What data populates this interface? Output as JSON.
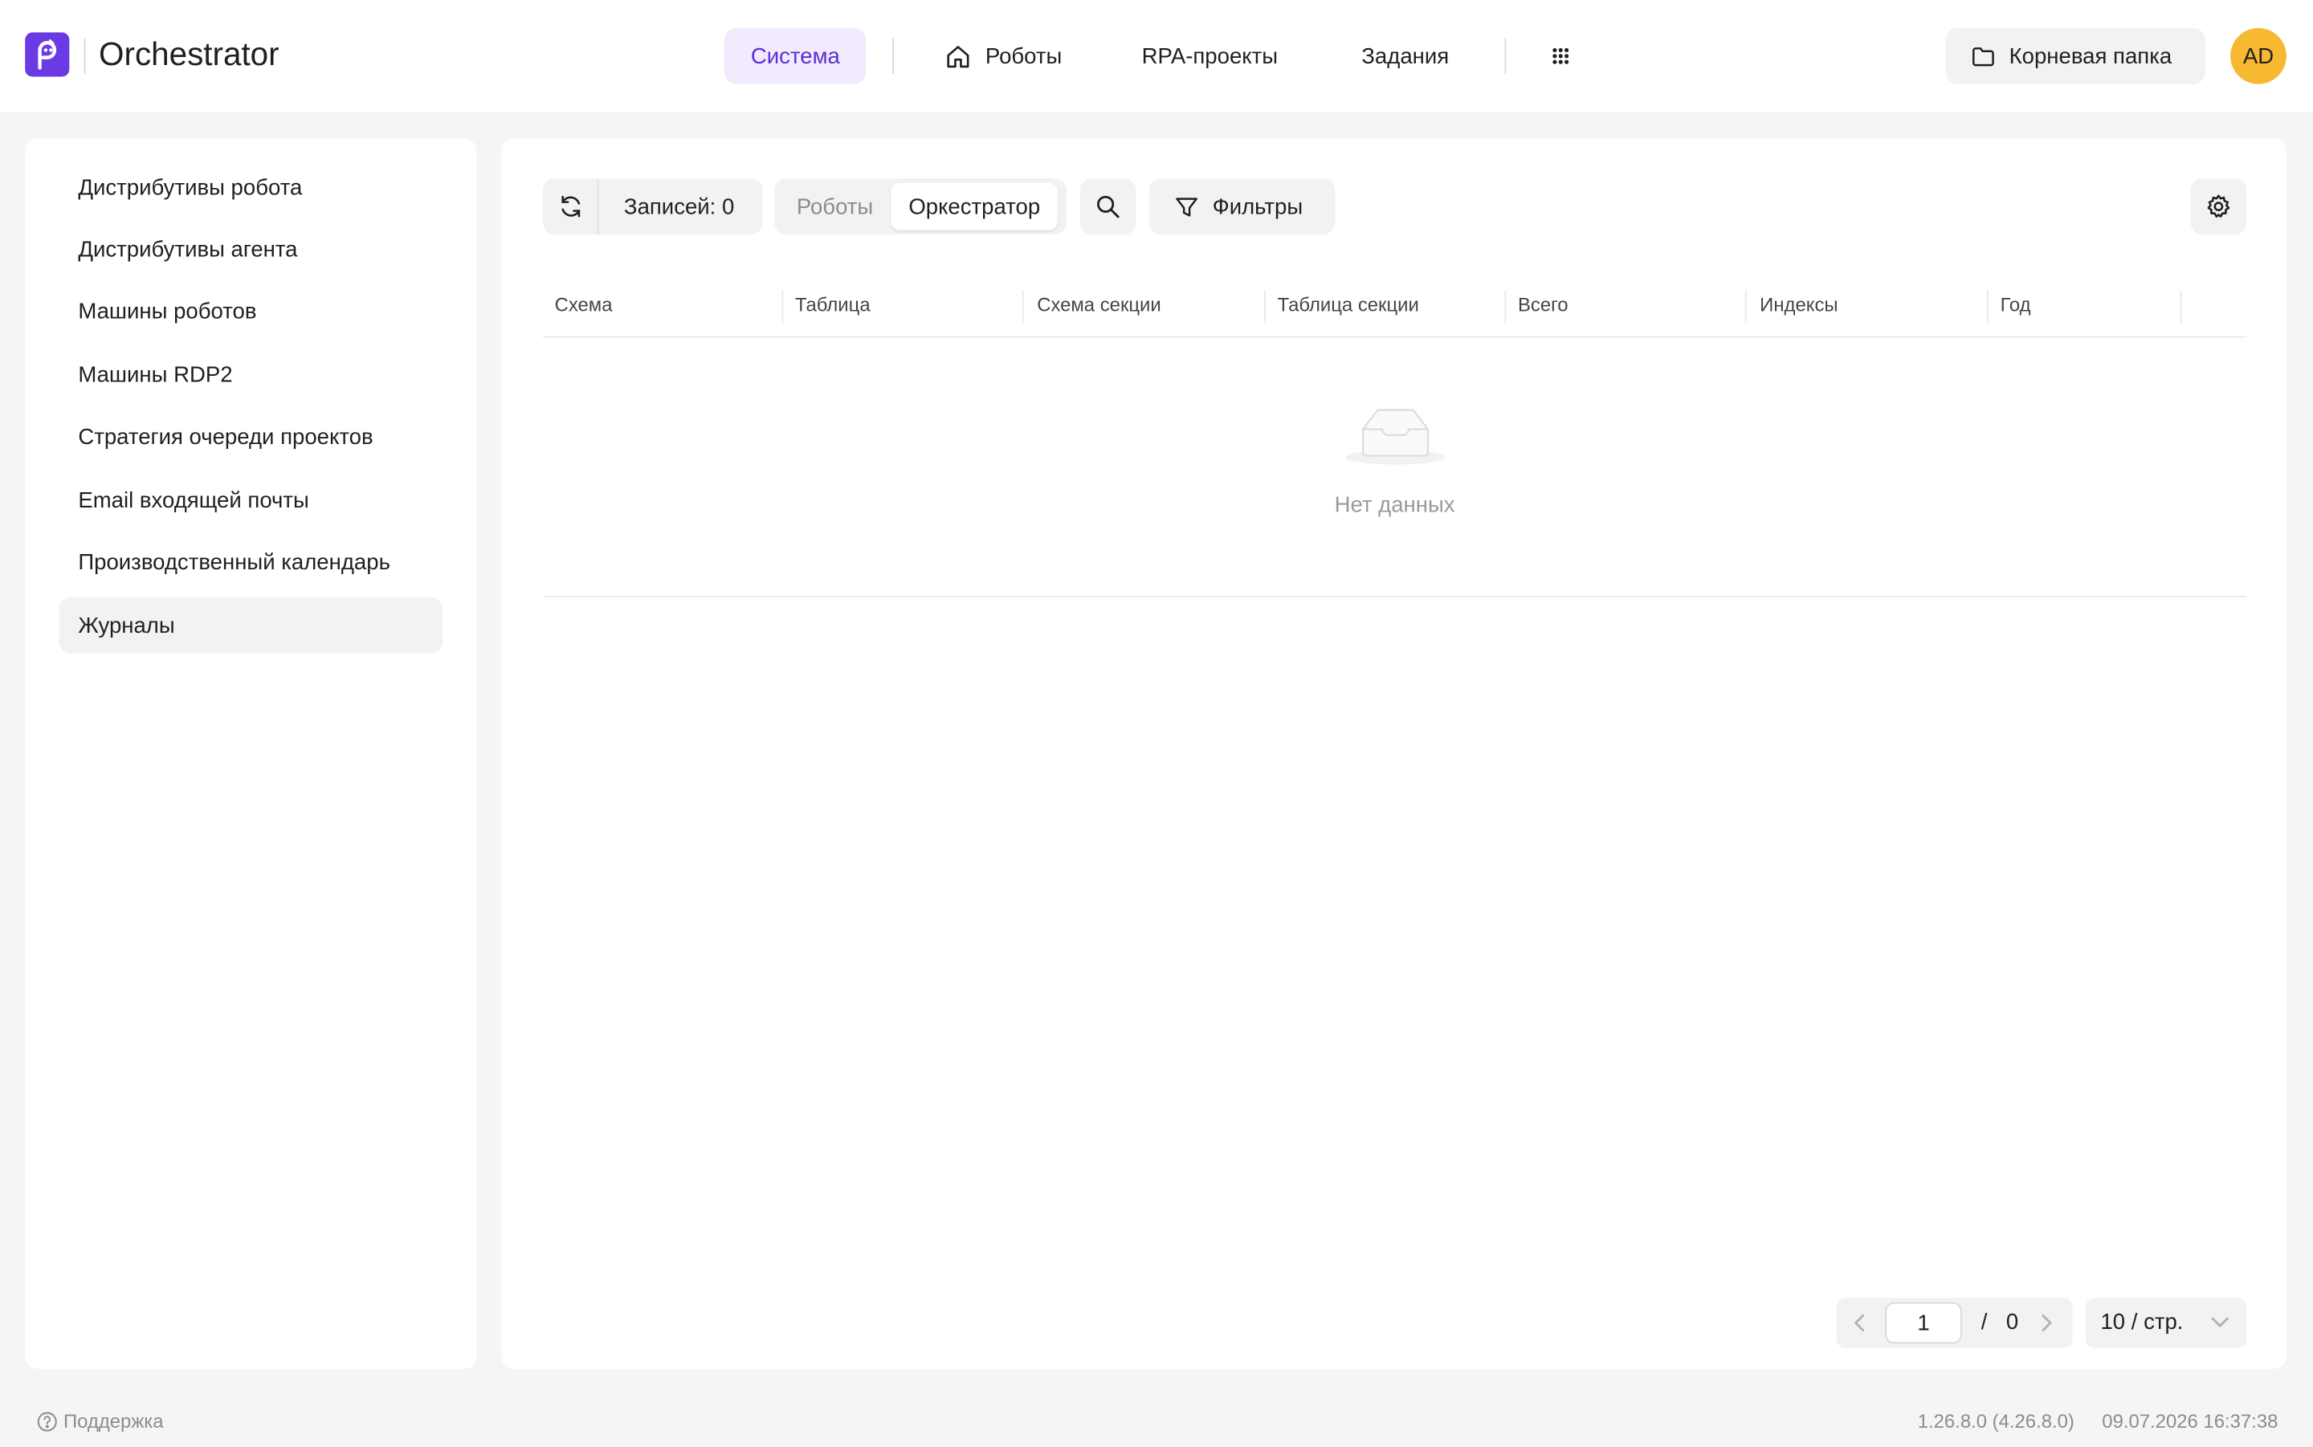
{
  "header": {
    "app_title": "Orchestrator",
    "nav": {
      "system": "Система",
      "robots": "Роботы",
      "rpa_projects": "RPA-проекты",
      "tasks": "Задания"
    },
    "root_folder": "Корневая папка",
    "avatar_initials": "AD",
    "accent_color": "#6a3be4",
    "avatar_color": "#f7b932"
  },
  "sidebar": {
    "items": [
      {
        "label": "Дистрибутивы робота"
      },
      {
        "label": "Дистрибутивы агента"
      },
      {
        "label": "Машины роботов"
      },
      {
        "label": "Машины RDP2"
      },
      {
        "label": "Стратегия очереди проектов"
      },
      {
        "label": "Email входящей почты"
      },
      {
        "label": "Производственный календарь"
      },
      {
        "label": "Журналы",
        "active": true
      }
    ]
  },
  "toolbar": {
    "records": "Записей: 0",
    "segment_robots": "Роботы",
    "segment_orchestrator": "Оркестратор",
    "filters": "Фильтры"
  },
  "table": {
    "columns": [
      "Схема",
      "Таблица",
      "Схема секции",
      "Таблица секции",
      "Всего",
      "Индексы",
      "Год"
    ],
    "empty_text": "Нет данных"
  },
  "pagination": {
    "current_page": "1",
    "separator": "/",
    "total_pages": "0",
    "page_size": "10 / стр."
  },
  "footer": {
    "support": "Поддержка",
    "version": "1.26.8.0 (4.26.8.0)",
    "datetime": "09.07.2026 16:37:38"
  }
}
